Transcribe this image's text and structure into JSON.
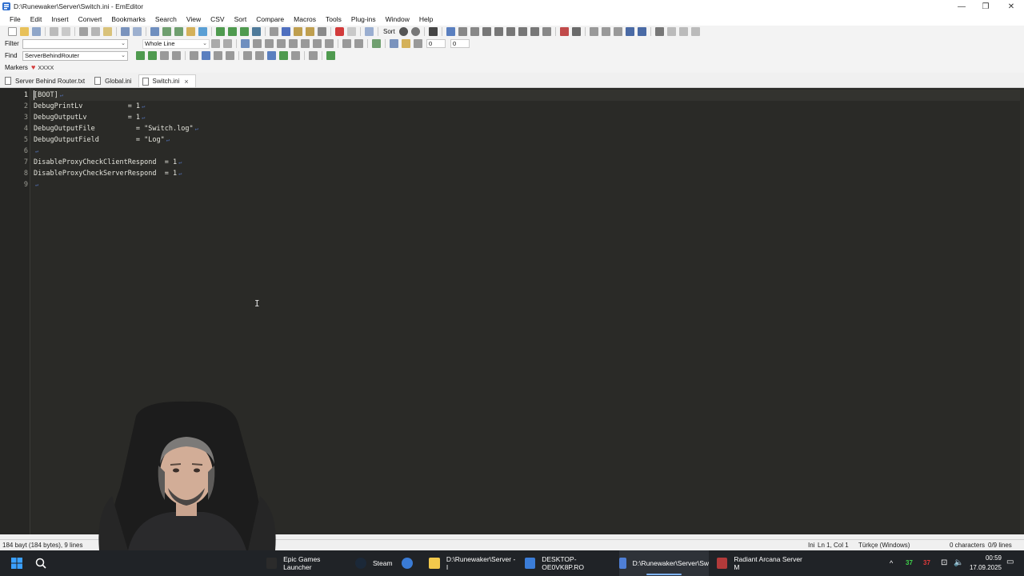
{
  "window": {
    "title": "D:\\Runewaker\\Server\\Switch.ini - EmEditor",
    "minimize": "—",
    "maximize": "❐",
    "close": "✕"
  },
  "menu": [
    "File",
    "Edit",
    "Insert",
    "Convert",
    "Bookmarks",
    "Search",
    "View",
    "CSV",
    "Sort",
    "Compare",
    "Macros",
    "Tools",
    "Plug-ins",
    "Window",
    "Help"
  ],
  "toolbar": {
    "sort_label": "Sort"
  },
  "filter": {
    "label": "Filter",
    "value": "",
    "mode": "Whole Line",
    "num1": "0",
    "num2": "0"
  },
  "find": {
    "label": "Find",
    "value": "ServerBehindRouter"
  },
  "markers": {
    "label": "Markers",
    "chip": "XXXX"
  },
  "tabs": [
    {
      "label": "Server Behind Router.txt",
      "active": false
    },
    {
      "label": "Global.ini",
      "active": false
    },
    {
      "label": "Switch.ini",
      "active": true
    }
  ],
  "editor": {
    "line_numbers": [
      "1",
      "2",
      "3",
      "4",
      "5",
      "6",
      "7",
      "8",
      "9"
    ],
    "lines": [
      "[BOOT]",
      "DebugPrintLv           = 1",
      "DebugOutputLv          = 1",
      "DebugOutputFile          = \"Switch.log\"",
      "DebugOutputField         = \"Log\"",
      "",
      "DisableProxyCheckClientRespond  = 1",
      "DisableProxyCheckServerRespond  = 1",
      ""
    ],
    "eol_glyph": "↵"
  },
  "status": {
    "size": "184 bayt (184 bytes), 9 lines",
    "mode": "Ini",
    "position": "Ln 1, Col 1",
    "encoding": "Türkçe (Windows)",
    "selection": "0 characters",
    "lines": "0/9 lines"
  },
  "taskbar": {
    "items": [
      {
        "label": "Epic Games Launcher",
        "icon_color": "#2b2b2b"
      },
      {
        "label": "Steam",
        "icon_color": "#1b2838"
      },
      {
        "label": "",
        "icon_color": "#3a7bd5"
      },
      {
        "label": "D:\\Runewaker\\Server - I",
        "icon_color": "#f2c94c"
      },
      {
        "label": "DESKTOP-OE0VK8P.RO",
        "icon_color": "#3b7dd8"
      },
      {
        "label": "D:\\Runewaker\\Server\\Sw",
        "icon_color": "#4f7fd6"
      },
      {
        "label": "Radiant Arcana Server M",
        "icon_color": "#b23a3a"
      }
    ],
    "tray_num1": "37",
    "tray_num2": "37",
    "time": "00:59",
    "date": "17.09.2025"
  }
}
